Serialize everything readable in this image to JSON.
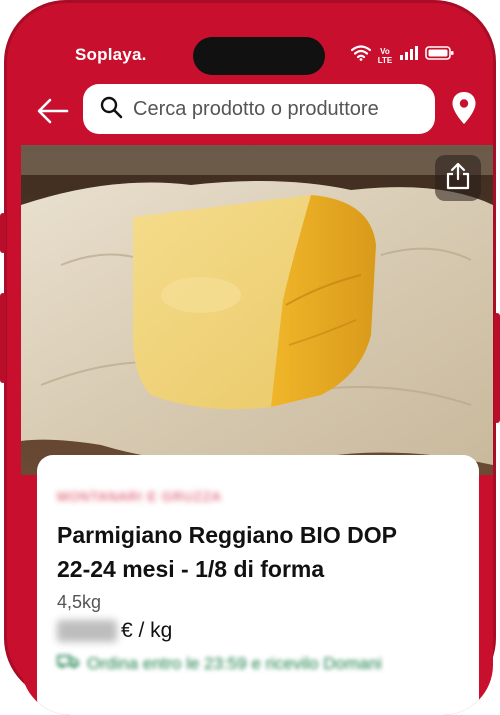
{
  "app": {
    "brand": "Soplaya",
    "brand_dot": "."
  },
  "status": {
    "network": "Vo LTE"
  },
  "search": {
    "placeholder": "Cerca prodotto o produttore"
  },
  "product": {
    "producer": "MONTANARI E GRUZZA",
    "title_line1": "Parmigiano Reggiano BIO DOP",
    "title_line2": "22-24 mesi - 1/8 di forma",
    "weight": "4,5kg",
    "price_unit": "€ / kg",
    "info_text": "Ordina entro le 23:59 e ricevilo Domani"
  },
  "colors": {
    "brand_red": "#c8102e",
    "card_bg": "#ffffff"
  }
}
